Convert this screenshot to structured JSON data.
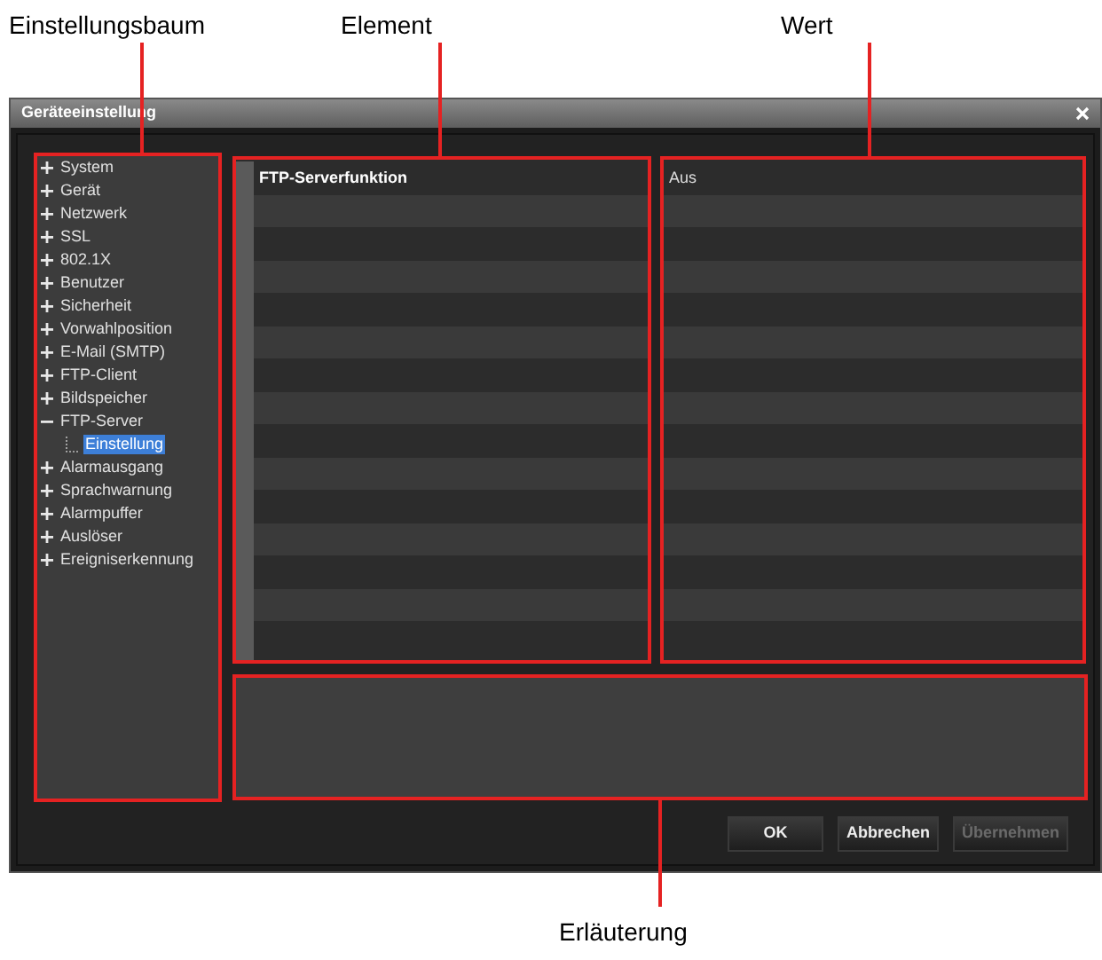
{
  "callouts": {
    "tree": "Einstellungsbaum",
    "element": "Element",
    "value": "Wert",
    "explanation": "Erläuterung"
  },
  "window": {
    "title": "Geräteeinstellung"
  },
  "tree": [
    {
      "label": "System",
      "expanded": false,
      "selected": false
    },
    {
      "label": "Gerät",
      "expanded": false,
      "selected": false
    },
    {
      "label": "Netzwerk",
      "expanded": false,
      "selected": false
    },
    {
      "label": "SSL",
      "expanded": false,
      "selected": false
    },
    {
      "label": "802.1X",
      "expanded": false,
      "selected": false
    },
    {
      "label": "Benutzer",
      "expanded": false,
      "selected": false
    },
    {
      "label": "Sicherheit",
      "expanded": false,
      "selected": false
    },
    {
      "label": "Vorwahlposition",
      "expanded": false,
      "selected": false
    },
    {
      "label": "E-Mail (SMTP)",
      "expanded": false,
      "selected": false
    },
    {
      "label": "FTP-Client",
      "expanded": false,
      "selected": false
    },
    {
      "label": "Bildspeicher",
      "expanded": false,
      "selected": false
    },
    {
      "label": "FTP-Server",
      "expanded": true,
      "selected": false,
      "children": [
        {
          "label": "Einstellung",
          "selected": true
        }
      ]
    },
    {
      "label": "Alarmausgang",
      "expanded": false,
      "selected": false
    },
    {
      "label": "Sprachwarnung",
      "expanded": false,
      "selected": false
    },
    {
      "label": "Alarmpuffer",
      "expanded": false,
      "selected": false
    },
    {
      "label": "Auslöser",
      "expanded": false,
      "selected": false
    },
    {
      "label": "Ereigniserkennung",
      "expanded": false,
      "selected": false
    }
  ],
  "table": {
    "rows": [
      {
        "element": "FTP-Serverfunktion",
        "value": "Aus"
      }
    ]
  },
  "buttons": [
    {
      "label": "OK",
      "disabled": false
    },
    {
      "label": "Abbrechen",
      "disabled": false
    },
    {
      "label": "Übernehmen",
      "disabled": true
    }
  ]
}
